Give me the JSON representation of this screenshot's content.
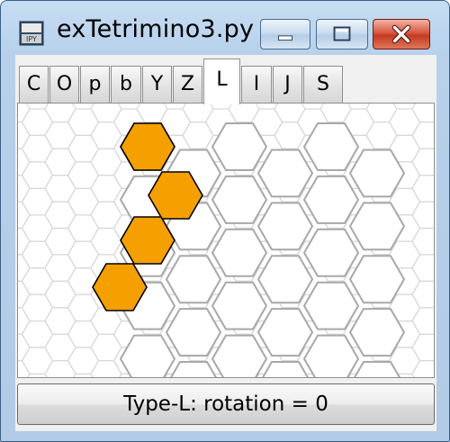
{
  "window": {
    "title": "exTetrimino3.py",
    "app_icon": "python-icon",
    "controls": {
      "minimize_icon": "minimize-icon",
      "maximize_icon": "maximize-icon",
      "close_icon": "close-icon"
    }
  },
  "tabs": [
    {
      "label": "C",
      "selected": false
    },
    {
      "label": "O",
      "selected": false
    },
    {
      "label": "p",
      "selected": false
    },
    {
      "label": "b",
      "selected": false
    },
    {
      "label": "Y",
      "selected": false
    },
    {
      "label": "Z",
      "selected": false
    },
    {
      "label": "L",
      "selected": true
    },
    {
      "label": "I",
      "selected": false
    },
    {
      "label": "J",
      "selected": false
    },
    {
      "label": "S",
      "selected": false
    }
  ],
  "board": {
    "piece": "L",
    "piece_color": "#f5a000",
    "outline_color": "#000000",
    "grid_color": "#a8a8a8",
    "faint_grid_color": "#d8d8d8"
  },
  "status": {
    "text": "Type-L: rotation = 0"
  }
}
